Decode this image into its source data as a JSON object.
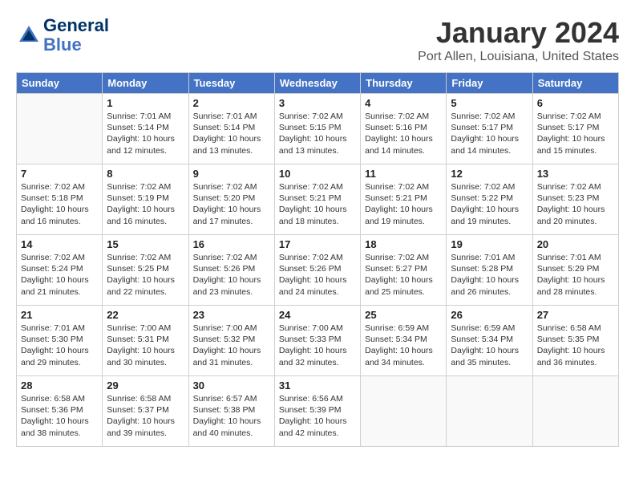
{
  "header": {
    "logo_line1": "General",
    "logo_line2": "Blue",
    "month_title": "January 2024",
    "location": "Port Allen, Louisiana, United States"
  },
  "weekdays": [
    "Sunday",
    "Monday",
    "Tuesday",
    "Wednesday",
    "Thursday",
    "Friday",
    "Saturday"
  ],
  "weeks": [
    [
      {
        "day": "",
        "info": ""
      },
      {
        "day": "1",
        "info": "Sunrise: 7:01 AM\nSunset: 5:14 PM\nDaylight: 10 hours\nand 12 minutes."
      },
      {
        "day": "2",
        "info": "Sunrise: 7:01 AM\nSunset: 5:14 PM\nDaylight: 10 hours\nand 13 minutes."
      },
      {
        "day": "3",
        "info": "Sunrise: 7:02 AM\nSunset: 5:15 PM\nDaylight: 10 hours\nand 13 minutes."
      },
      {
        "day": "4",
        "info": "Sunrise: 7:02 AM\nSunset: 5:16 PM\nDaylight: 10 hours\nand 14 minutes."
      },
      {
        "day": "5",
        "info": "Sunrise: 7:02 AM\nSunset: 5:17 PM\nDaylight: 10 hours\nand 14 minutes."
      },
      {
        "day": "6",
        "info": "Sunrise: 7:02 AM\nSunset: 5:17 PM\nDaylight: 10 hours\nand 15 minutes."
      }
    ],
    [
      {
        "day": "7",
        "info": "Sunrise: 7:02 AM\nSunset: 5:18 PM\nDaylight: 10 hours\nand 16 minutes."
      },
      {
        "day": "8",
        "info": "Sunrise: 7:02 AM\nSunset: 5:19 PM\nDaylight: 10 hours\nand 16 minutes."
      },
      {
        "day": "9",
        "info": "Sunrise: 7:02 AM\nSunset: 5:20 PM\nDaylight: 10 hours\nand 17 minutes."
      },
      {
        "day": "10",
        "info": "Sunrise: 7:02 AM\nSunset: 5:21 PM\nDaylight: 10 hours\nand 18 minutes."
      },
      {
        "day": "11",
        "info": "Sunrise: 7:02 AM\nSunset: 5:21 PM\nDaylight: 10 hours\nand 19 minutes."
      },
      {
        "day": "12",
        "info": "Sunrise: 7:02 AM\nSunset: 5:22 PM\nDaylight: 10 hours\nand 19 minutes."
      },
      {
        "day": "13",
        "info": "Sunrise: 7:02 AM\nSunset: 5:23 PM\nDaylight: 10 hours\nand 20 minutes."
      }
    ],
    [
      {
        "day": "14",
        "info": "Sunrise: 7:02 AM\nSunset: 5:24 PM\nDaylight: 10 hours\nand 21 minutes."
      },
      {
        "day": "15",
        "info": "Sunrise: 7:02 AM\nSunset: 5:25 PM\nDaylight: 10 hours\nand 22 minutes."
      },
      {
        "day": "16",
        "info": "Sunrise: 7:02 AM\nSunset: 5:26 PM\nDaylight: 10 hours\nand 23 minutes."
      },
      {
        "day": "17",
        "info": "Sunrise: 7:02 AM\nSunset: 5:26 PM\nDaylight: 10 hours\nand 24 minutes."
      },
      {
        "day": "18",
        "info": "Sunrise: 7:02 AM\nSunset: 5:27 PM\nDaylight: 10 hours\nand 25 minutes."
      },
      {
        "day": "19",
        "info": "Sunrise: 7:01 AM\nSunset: 5:28 PM\nDaylight: 10 hours\nand 26 minutes."
      },
      {
        "day": "20",
        "info": "Sunrise: 7:01 AM\nSunset: 5:29 PM\nDaylight: 10 hours\nand 28 minutes."
      }
    ],
    [
      {
        "day": "21",
        "info": "Sunrise: 7:01 AM\nSunset: 5:30 PM\nDaylight: 10 hours\nand 29 minutes."
      },
      {
        "day": "22",
        "info": "Sunrise: 7:00 AM\nSunset: 5:31 PM\nDaylight: 10 hours\nand 30 minutes."
      },
      {
        "day": "23",
        "info": "Sunrise: 7:00 AM\nSunset: 5:32 PM\nDaylight: 10 hours\nand 31 minutes."
      },
      {
        "day": "24",
        "info": "Sunrise: 7:00 AM\nSunset: 5:33 PM\nDaylight: 10 hours\nand 32 minutes."
      },
      {
        "day": "25",
        "info": "Sunrise: 6:59 AM\nSunset: 5:34 PM\nDaylight: 10 hours\nand 34 minutes."
      },
      {
        "day": "26",
        "info": "Sunrise: 6:59 AM\nSunset: 5:34 PM\nDaylight: 10 hours\nand 35 minutes."
      },
      {
        "day": "27",
        "info": "Sunrise: 6:58 AM\nSunset: 5:35 PM\nDaylight: 10 hours\nand 36 minutes."
      }
    ],
    [
      {
        "day": "28",
        "info": "Sunrise: 6:58 AM\nSunset: 5:36 PM\nDaylight: 10 hours\nand 38 minutes."
      },
      {
        "day": "29",
        "info": "Sunrise: 6:58 AM\nSunset: 5:37 PM\nDaylight: 10 hours\nand 39 minutes."
      },
      {
        "day": "30",
        "info": "Sunrise: 6:57 AM\nSunset: 5:38 PM\nDaylight: 10 hours\nand 40 minutes."
      },
      {
        "day": "31",
        "info": "Sunrise: 6:56 AM\nSunset: 5:39 PM\nDaylight: 10 hours\nand 42 minutes."
      },
      {
        "day": "",
        "info": ""
      },
      {
        "day": "",
        "info": ""
      },
      {
        "day": "",
        "info": ""
      }
    ]
  ]
}
